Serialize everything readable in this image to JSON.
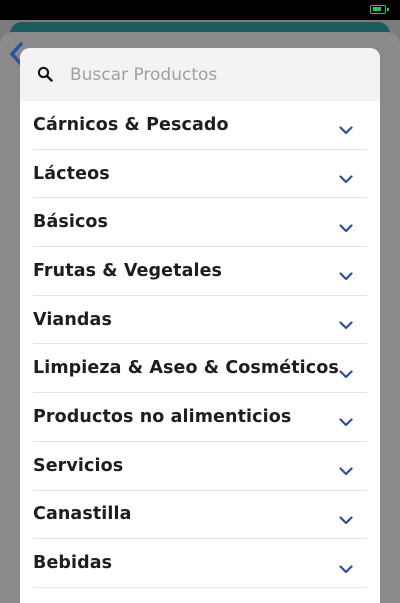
{
  "search": {
    "placeholder": "Buscar Productos"
  },
  "categories": [
    {
      "label": "Cárnicos & Pescado"
    },
    {
      "label": "Lácteos"
    },
    {
      "label": "Básicos"
    },
    {
      "label": "Frutas & Vegetales"
    },
    {
      "label": "Viandas"
    },
    {
      "label": "Limpieza & Aseo & Cosméticos"
    },
    {
      "label": "Productos no alimenticios"
    },
    {
      "label": "Servicios"
    },
    {
      "label": "Canastilla"
    },
    {
      "label": "Bebidas"
    }
  ],
  "icons": {
    "search": "search-icon",
    "chevron": "chevron-down-icon",
    "back": "chevron-left-icon",
    "battery": "battery-icon"
  },
  "colors": {
    "chevron": "#2d4f9e",
    "backdrop": "#7c7c7c",
    "header": "#1e5c5c",
    "battery": "#22c55e"
  }
}
